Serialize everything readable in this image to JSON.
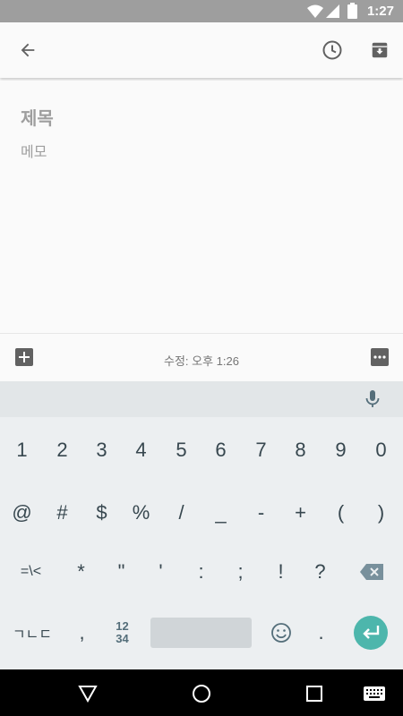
{
  "status_bar": {
    "time": "1:27",
    "icons": [
      "wifi-icon",
      "signal-icon",
      "battery-icon"
    ]
  },
  "toolbar": {
    "icons": [
      "back-arrow-icon",
      "reminder-clock-icon",
      "archive-icon"
    ]
  },
  "note": {
    "title_placeholder": "제목",
    "body_placeholder": "메모"
  },
  "note_bar": {
    "edited_label": "수정: 오후 1:26",
    "icons": [
      "add-box-icon",
      "more-options-icon"
    ]
  },
  "keyboard": {
    "row1": [
      "1",
      "2",
      "3",
      "4",
      "5",
      "6",
      "7",
      "8",
      "9",
      "0"
    ],
    "row2": [
      "@",
      "#",
      "$",
      "%",
      "/",
      "_",
      "-",
      "+",
      "(",
      ")"
    ],
    "row3": [
      "=\\<",
      "*",
      "\"",
      "'",
      ":",
      ";",
      "!",
      "?"
    ],
    "row4": {
      "lang_key": "ㄱㄴㄷ",
      "comma": ",",
      "numpad_top": "12",
      "numpad_bottom": "34",
      "period": "."
    },
    "icons": [
      "mic-icon",
      "backspace-icon",
      "emoji-icon",
      "enter-icon"
    ],
    "accent_color": "#4db6ac"
  },
  "nav_bar": {
    "icons": [
      "back-triangle-icon",
      "home-circle-icon",
      "recents-square-icon",
      "keyboard-switch-icon"
    ]
  }
}
